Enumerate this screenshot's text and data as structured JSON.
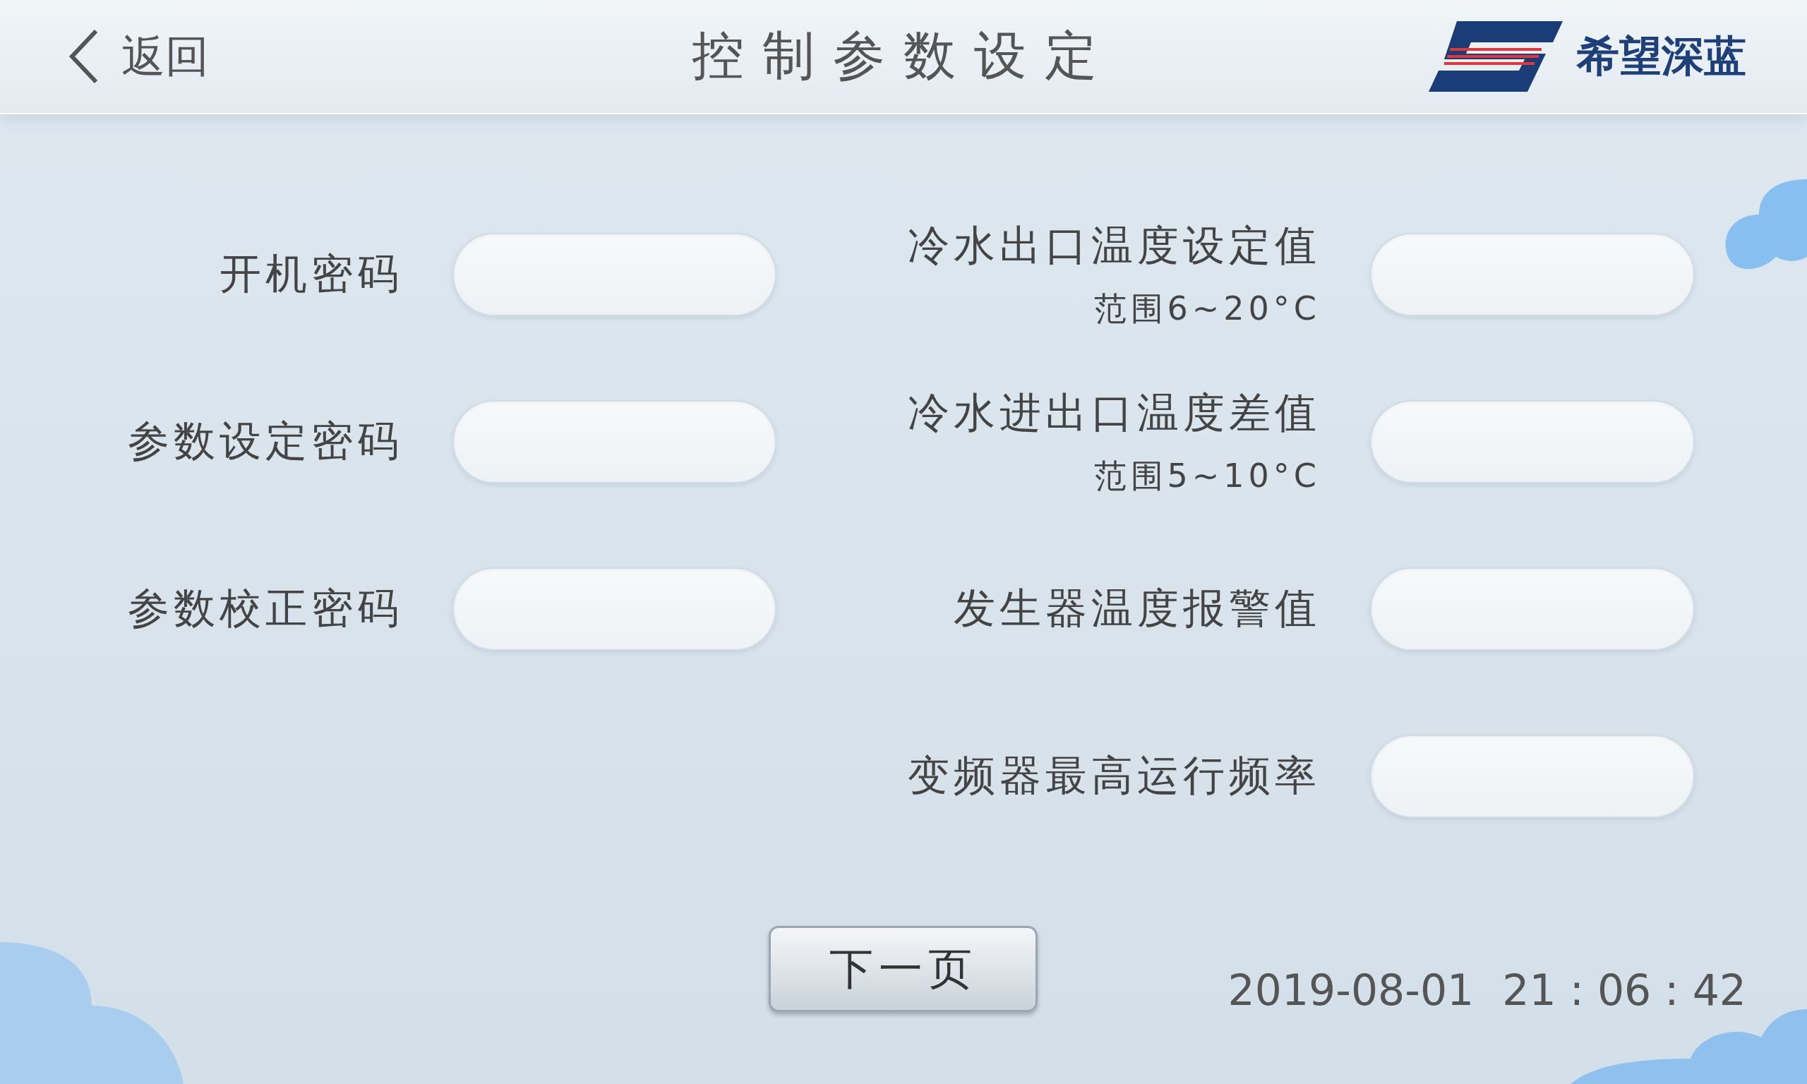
{
  "header": {
    "back_label": "返回",
    "title": "控制参数设定",
    "brand": "希望深蓝"
  },
  "left_fields": [
    {
      "label": "开机密码"
    },
    {
      "label": "参数设定密码"
    },
    {
      "label": "参数校正密码"
    }
  ],
  "right_fields": [
    {
      "label": "冷水出口温度设定值",
      "range": "范围6~20°C"
    },
    {
      "label": "冷水进出口温度差值",
      "range": "范围5~10°C"
    },
    {
      "label": "发生器温度报警值"
    },
    {
      "label": "变频器最高运行频率"
    }
  ],
  "next_button": "下一页",
  "datetime": {
    "date": "2019-08-01",
    "time": "21 : 06 : 42"
  }
}
